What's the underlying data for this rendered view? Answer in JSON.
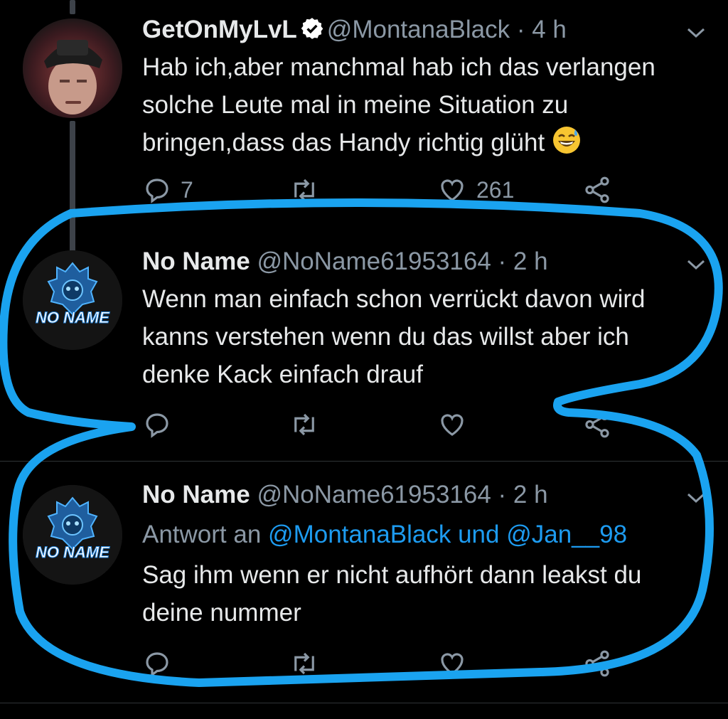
{
  "tweets": [
    {
      "name": "GetOnMyLvL",
      "handle": "@MontanaBlack",
      "time": "4 h",
      "verified": true,
      "text_lines": [
        "Hab ich,aber manchmal hab ich das verlangen",
        "solche Leute mal in meine Situation zu",
        "bringen,dass das Handy richtig glüht"
      ],
      "emoji": "grinning-face-with-sweat",
      "reply_count": "7",
      "like_count": "261"
    },
    {
      "name": "No Name",
      "handle": "@NoName61953164",
      "time": "2 h",
      "avatar_text": "NO NAME",
      "text_lines": [
        "Wenn man einfach schon verrückt davon wird",
        "kanns verstehen wenn du das willst aber ich",
        "denke Kack einfach drauf"
      ]
    },
    {
      "name": "No Name",
      "handle": "@NoName61953164",
      "time": "2 h",
      "avatar_text": "NO NAME",
      "reply_to_prefix": "Antwort an",
      "reply_to_mentions": "@MontanaBlack und @Jan__98",
      "text_lines": [
        "Sag ihm wenn er nicht aufhört dann leakst du",
        "deine nummer"
      ]
    }
  ],
  "separator": " · ",
  "colors": {
    "background": "#000000",
    "text": "#e7e9ea",
    "muted": "#8b98a5",
    "link": "#1d9bf0",
    "verified": "#ffffff",
    "highlight": "#1aa3f0"
  },
  "icons": [
    "reply-icon",
    "retweet-icon",
    "like-icon",
    "share-icon",
    "chevron-down-icon",
    "verified-icon"
  ]
}
